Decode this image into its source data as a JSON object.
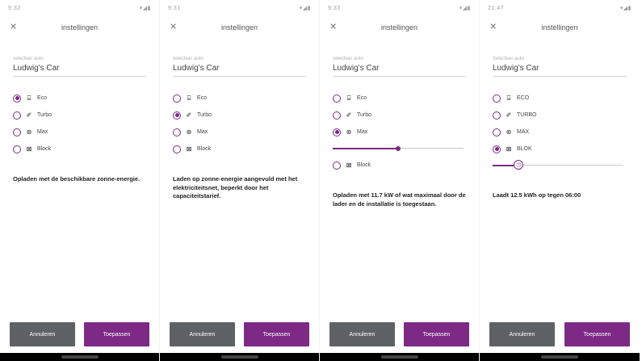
{
  "accent_color": "#7d2a86",
  "cancel_color": "#5e6266",
  "screens": [
    {
      "status_time": "9:32",
      "status_right": "▾◢▮",
      "title": "instellingen",
      "field_label": "selecteer auto",
      "car_name": "Ludwig's Car",
      "options": [
        {
          "label": "Eco",
          "icon": "solar-panel-icon",
          "glyph": "⌸",
          "selected": true
        },
        {
          "label": "Turbo",
          "icon": "plug-icon",
          "glyph": "✐",
          "selected": false
        },
        {
          "label": "Max",
          "icon": "max-icon",
          "glyph": "⊛",
          "selected": false
        },
        {
          "label": "Block",
          "icon": "block-icon",
          "glyph": "⊠",
          "selected": false
        }
      ],
      "description": "Opladen met de beschikbare zonne-energie.",
      "cancel_label": "Annuleren",
      "apply_label": "Toepassen"
    },
    {
      "status_time": "9:31",
      "status_right": "▾◢▮",
      "title": "instellingen",
      "field_label": "selecteer auto",
      "car_name": "Ludwig's Car",
      "options": [
        {
          "label": "Eco",
          "icon": "solar-panel-icon",
          "glyph": "⌸",
          "selected": false
        },
        {
          "label": "Turbo",
          "icon": "plug-icon",
          "glyph": "✐",
          "selected": true
        },
        {
          "label": "Max",
          "icon": "max-icon",
          "glyph": "⊛",
          "selected": false
        },
        {
          "label": "Block",
          "icon": "block-icon",
          "glyph": "⊠",
          "selected": false
        }
      ],
      "description": "Laden op zonne-energie aangevuld met het elektriciteitsnet, beperkt door het capaciteitstarief.",
      "cancel_label": "Annuleren",
      "apply_label": "Toepassen"
    },
    {
      "status_time": "9:33",
      "status_right": "▾◢▮",
      "title": "instellingen",
      "field_label": "selecteer auto",
      "car_name": "Ludwig's Car",
      "options": [
        {
          "label": "Eco",
          "icon": "solar-panel-icon",
          "glyph": "⌸",
          "selected": false
        },
        {
          "label": "Turbo",
          "icon": "plug-icon",
          "glyph": "✐",
          "selected": false
        },
        {
          "label": "Max",
          "icon": "max-icon",
          "glyph": "⊛",
          "selected": true
        },
        {
          "label": "Block",
          "icon": "block-icon",
          "glyph": "⊠",
          "selected": false
        }
      ],
      "slider": {
        "after_option": 2,
        "value": 0.5,
        "style": "dot"
      },
      "description": "Opladen met 11.7 kW of wat maximaal door de lader en de installatie is toegestaan.",
      "cancel_label": "Annuleren",
      "apply_label": "Toepassen"
    },
    {
      "status_time": "21:47",
      "status_right": "▾◢▮",
      "title": "instellingen",
      "field_label": "Selecteer auto",
      "car_name": "Ludwig's Car",
      "options": [
        {
          "label": "ECO",
          "icon": "solar-panel-icon",
          "glyph": "⌸",
          "selected": false
        },
        {
          "label": "TURBO",
          "icon": "plug-icon",
          "glyph": "✐",
          "selected": false
        },
        {
          "label": "MAX",
          "icon": "max-icon",
          "glyph": "⊛",
          "selected": false
        },
        {
          "label": "BLOK",
          "icon": "block-icon",
          "glyph": "⊠",
          "selected": true
        }
      ],
      "slider": {
        "after_option": 3,
        "value": 0.2,
        "style": "knob",
        "knob_glyph": "🕓"
      },
      "description": "Laadt 12.5 kWh op tegen 06:00",
      "cancel_label": "Annuleren",
      "apply_label": "Toepassen"
    }
  ]
}
